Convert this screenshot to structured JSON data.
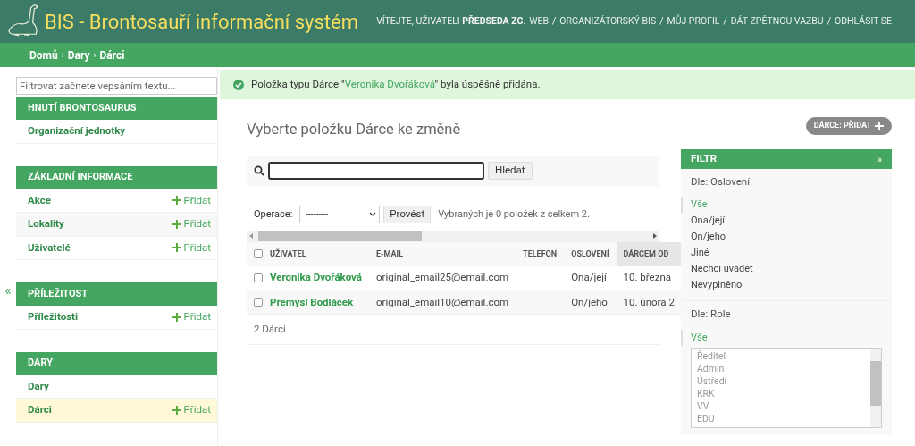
{
  "header": {
    "title": "BIS - Brontosauří informační systém",
    "welcome": "VÍTEJTE, UŽIVATELI **PŘEDSEDA ZC**.",
    "separator": "/",
    "links": [
      "WEB",
      "ORGANIZÁTORSKÝ BIS",
      "MŮJ PROFIL",
      "DÁT ZPĚTNOU VAZBU",
      "ODHLÁSIT SE"
    ]
  },
  "breadcrumbs": {
    "separator": "›",
    "items": [
      "Domů",
      "Dary",
      "Dárci"
    ]
  },
  "sidebar": {
    "filter_placeholder": "Filtrovat začnete vepsáním textu...",
    "collapse": "«",
    "sections": [
      {
        "title": "HNUTÍ BRONTOSAURUS",
        "items": [
          {
            "label": "Organizační jednotky",
            "selected": false
          }
        ]
      },
      {
        "title": "ZÁKLADNÍ INFORMACE",
        "items": [
          {
            "label": "Akce",
            "add_label": "Přidat",
            "selected": false
          },
          {
            "label": "Lokality",
            "add_label": "Přidat",
            "selected": false
          },
          {
            "label": "Uživatelé",
            "add_label": "Přidat",
            "selected": false
          }
        ]
      },
      {
        "title": "PŘÍLEŽITOST",
        "items": [
          {
            "label": "Příležitosti",
            "add_label": "Přidat",
            "selected": false
          }
        ]
      },
      {
        "title": "DARY",
        "items": [
          {
            "label": "Dary",
            "selected": false
          },
          {
            "label": "Dárci",
            "add_label": "Přidat",
            "selected": true
          }
        ]
      }
    ]
  },
  "message": {
    "prefix": "Položka typu Dárce \"",
    "link": "Veronika Dvořáková",
    "suffix": "\" byla úspěšně přidána."
  },
  "page_title": "Vyberte položku Dárce ke změně",
  "add_button": "DÁRCE: PŘIDAT",
  "search": {
    "button": "Hledat"
  },
  "actions": {
    "label": "Operace:",
    "select_value": "---------",
    "button": "Provést",
    "counter": "Vybraných je 0 položek z celkem 2."
  },
  "table": {
    "select_all_checked": false,
    "columns": [
      {
        "label": "UŽIVATEL",
        "sorted": false
      },
      {
        "label": "E-MAIL",
        "sorted": false
      },
      {
        "label": "TELEFON",
        "sorted": false
      },
      {
        "label": "OSLOVENÍ",
        "sorted": false
      },
      {
        "label": "DÁRCEM OD",
        "sorted": true
      }
    ],
    "rows": [
      {
        "selected": false,
        "cells": [
          "Veronika Dvořáková",
          "original_email25@email.com",
          "",
          "Ona/její",
          "10. března"
        ]
      },
      {
        "selected": false,
        "cells": [
          "Přemysl Bodláček",
          "original_email10@email.com",
          "",
          "On/jeho",
          "10. února 2"
        ]
      }
    ],
    "footer": "2 Dárci"
  },
  "filter": {
    "title": "FILTR",
    "toggle": "»",
    "groups": [
      {
        "title": "Dle: Oslovení",
        "kind": "links",
        "options": [
          {
            "label": "Vše",
            "selected": true
          },
          {
            "label": "Ona/její",
            "selected": false
          },
          {
            "label": "On/jeho",
            "selected": false
          },
          {
            "label": "Jiné",
            "selected": false
          },
          {
            "label": "Nechci uvádět",
            "selected": false
          },
          {
            "label": "Nevyplněno",
            "selected": false
          }
        ]
      },
      {
        "title": "Dle: Role",
        "kind": "listbox",
        "all": {
          "label": "Vše",
          "selected": true
        },
        "options": [
          "Ředitel",
          "Admin",
          "Ústředí",
          "KRK",
          "VV",
          "EDU"
        ]
      }
    ]
  }
}
